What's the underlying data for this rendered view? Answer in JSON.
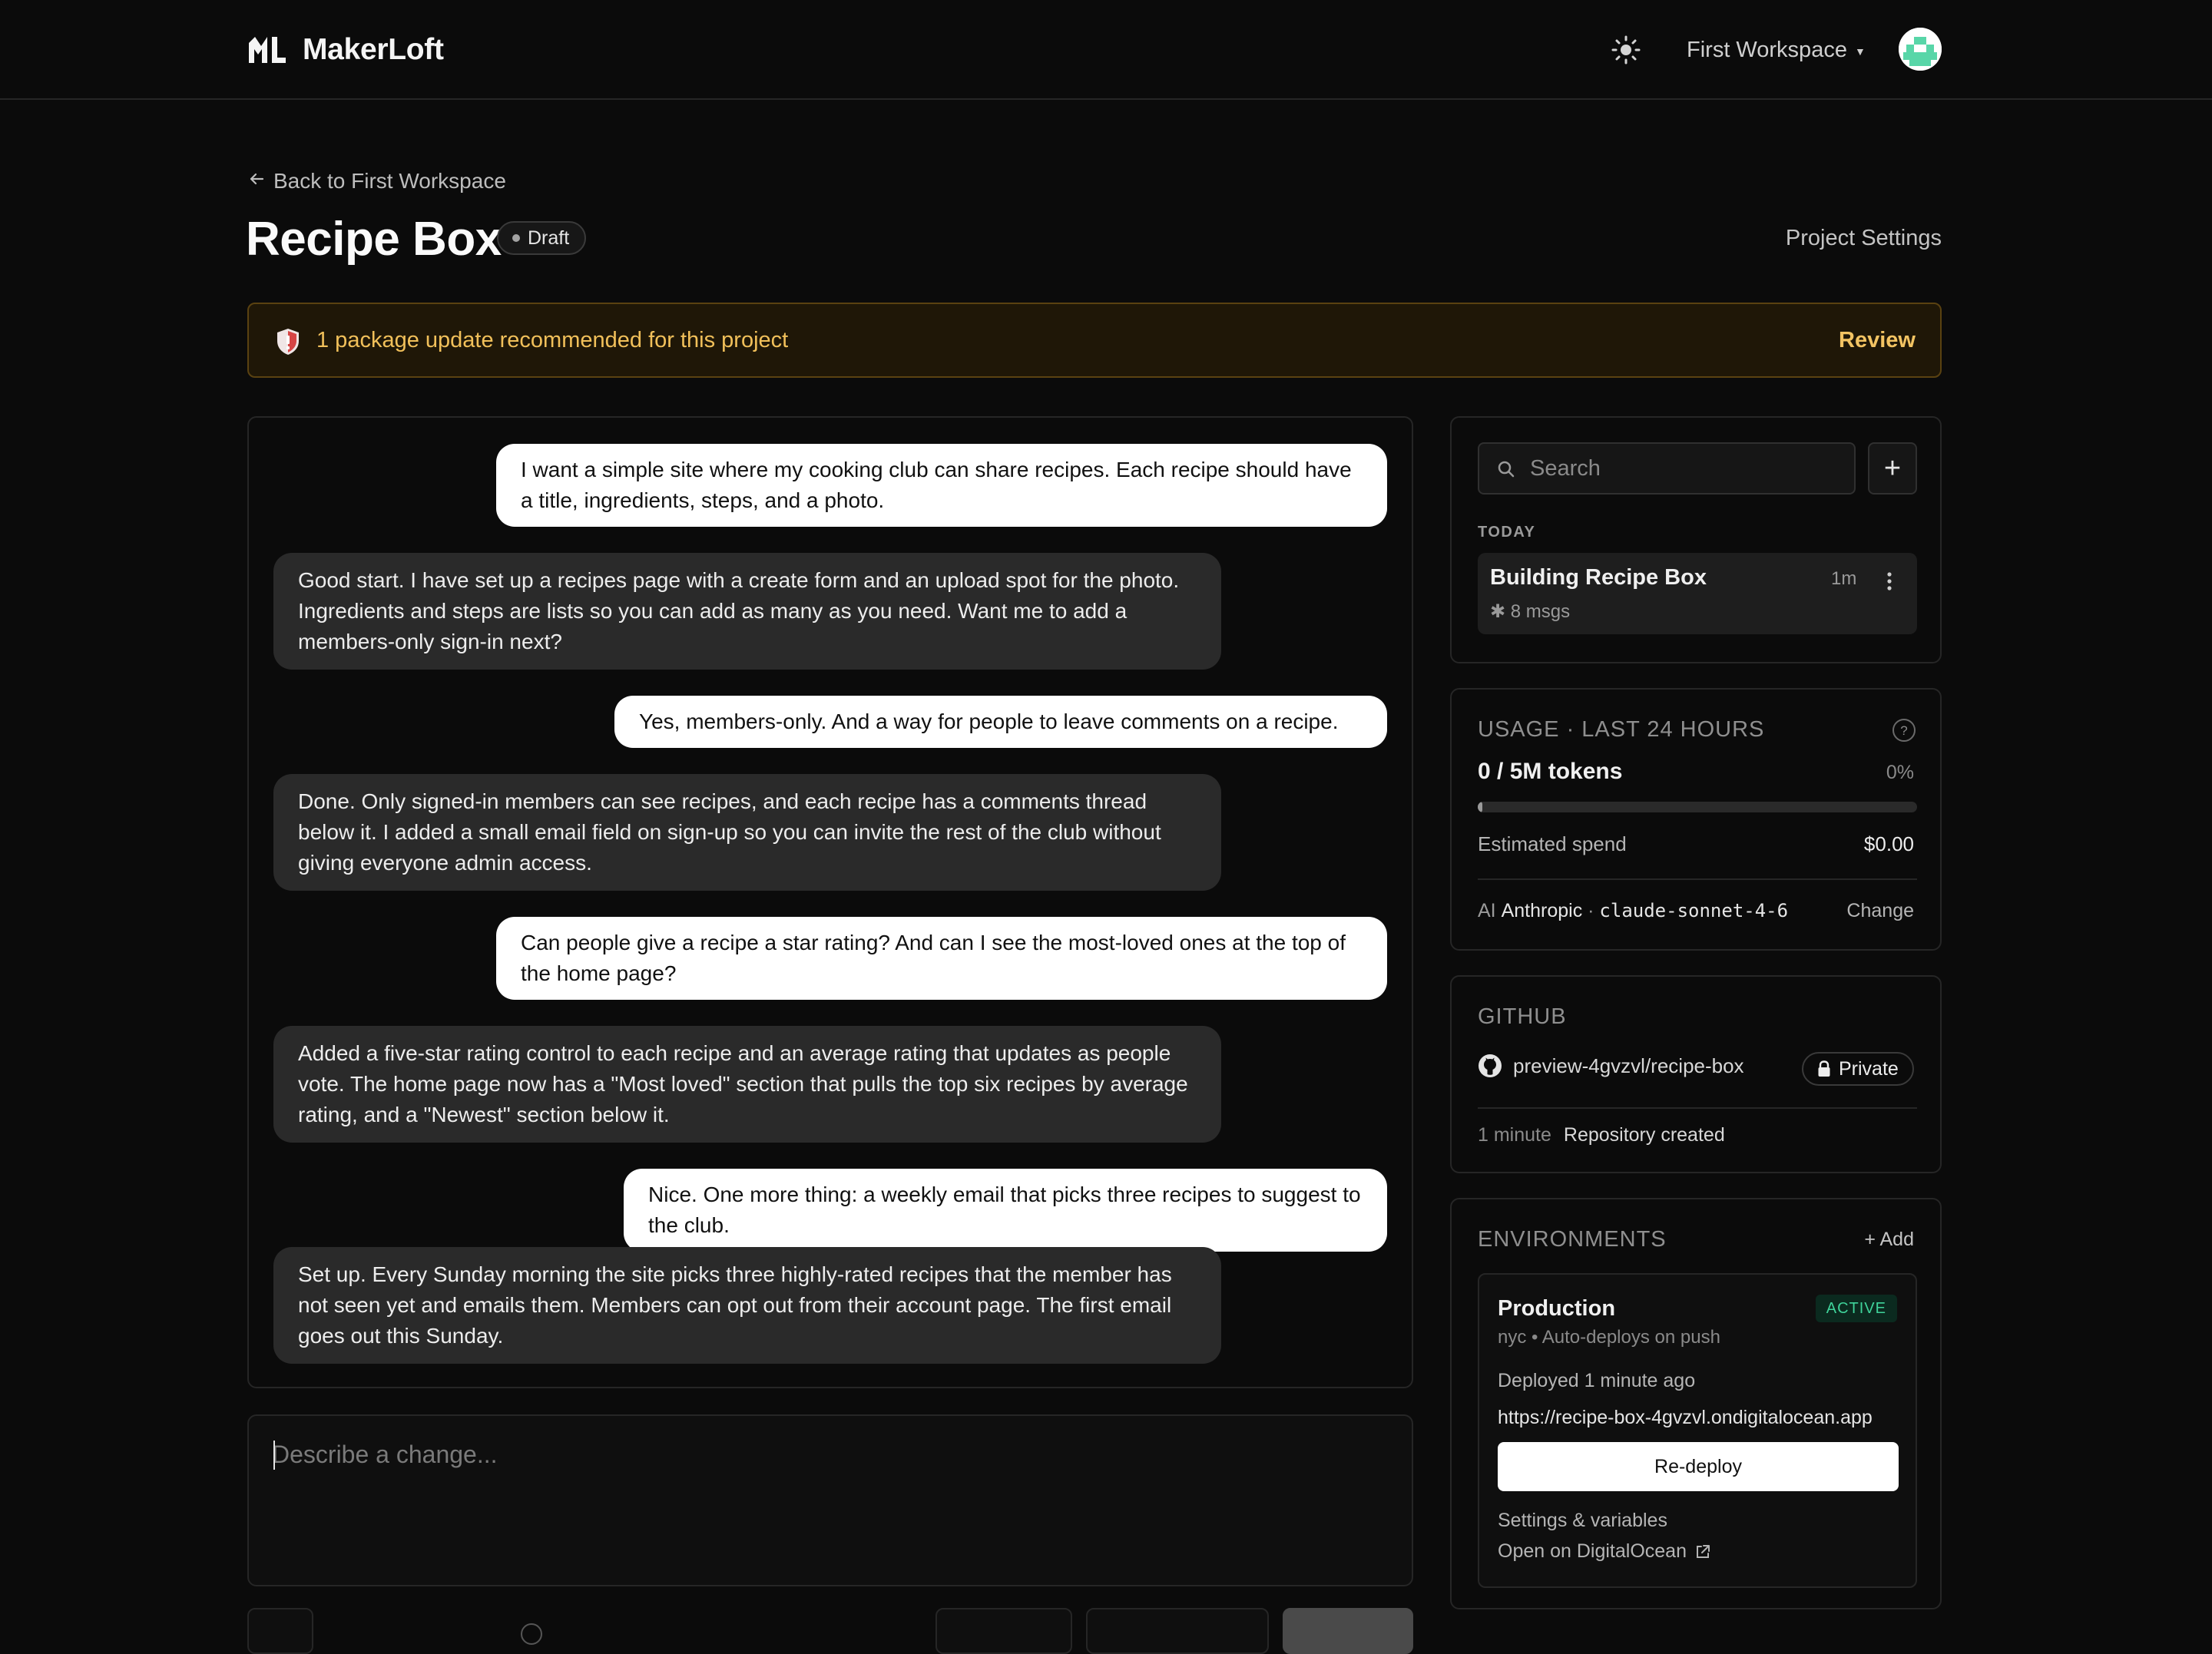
{
  "app": {
    "brand_name": "MakerLoft",
    "workspace_name": "First Workspace"
  },
  "header": {
    "back_label": "Back to First Workspace",
    "title": "Recipe Box",
    "status": "Draft",
    "settings_label": "Project Settings"
  },
  "alert": {
    "message": "1 package update recommended for this project",
    "action_label": "Review"
  },
  "chat": {
    "messages": [
      {
        "role": "user",
        "text": "I want a simple site where my cooking club can share recipes. Each recipe should have a title, ingredients, steps, and a photo."
      },
      {
        "role": "assistant",
        "text": "Good start. I have set up a recipes page with a create form and an upload spot for the photo. Ingredients and steps are lists so you can add as many as you need. Want me to add a members-only sign-in next?"
      },
      {
        "role": "user",
        "text": "Yes, members-only. And a way for people to leave comments on a recipe."
      },
      {
        "role": "assistant",
        "text": "Done. Only signed-in members can see recipes, and each recipe has a comments thread below it. I added a small email field on sign-up so you can invite the rest of the club without giving everyone admin access."
      },
      {
        "role": "user",
        "text": "Can people give a recipe a star rating? And can I see the most-loved ones at the top of the home page?"
      },
      {
        "role": "assistant",
        "text": "Added a five-star rating control to each recipe and an average rating that updates as people vote. The home page now has a \"Most loved\" section that pulls the top six recipes by average rating, and a \"Newest\" section below it."
      },
      {
        "role": "user",
        "text": "Nice. One more thing: a weekly email that picks three recipes to suggest to the club."
      },
      {
        "role": "assistant",
        "text": "Set up. Every Sunday morning the site picks three highly-rated recipes that the member has not seen yet and emails them. Members can opt out from their account page. The first email goes out this Sunday."
      }
    ],
    "composer_placeholder": "Describe a change..."
  },
  "history": {
    "search_placeholder": "Search",
    "group_label": "TODAY",
    "conversation": {
      "title": "Building Recipe Box",
      "time": "1m",
      "msgs": "8 msgs"
    }
  },
  "usage": {
    "heading": "USAGE · LAST 24 HOURS",
    "tokens": "0 / 5M tokens",
    "percent_label": "0%",
    "progress_fraction": 0.01,
    "spend_label": "Estimated spend",
    "spend_value": "$0.00",
    "ai_prefix": "AI ",
    "provider": "Anthropic",
    "separator": " · ",
    "model": "claude-sonnet-4-6",
    "change_label": "Change"
  },
  "github": {
    "heading": "GITHUB",
    "repo": "preview-4gvzvl/recipe-box",
    "visibility": "Private",
    "activity_time": "1 minute",
    "activity_text": "Repository created"
  },
  "environments": {
    "heading": "ENVIRONMENTS",
    "add_label": "+ Add",
    "items": [
      {
        "name": "Production",
        "status": "ACTIVE",
        "meta": "nyc • Auto-deploys on push",
        "deployed": "Deployed 1 minute ago",
        "url": "https://recipe-box-4gvzvl.ondigitalocean.app",
        "redeploy_label": "Re-deploy",
        "settings_label": "Settings & variables",
        "open_label": "Open on DigitalOcean"
      }
    ]
  },
  "colors": {
    "background": "#0b0b0b",
    "alert_text": "#f1c05a",
    "active_green": "#3fd39a"
  }
}
